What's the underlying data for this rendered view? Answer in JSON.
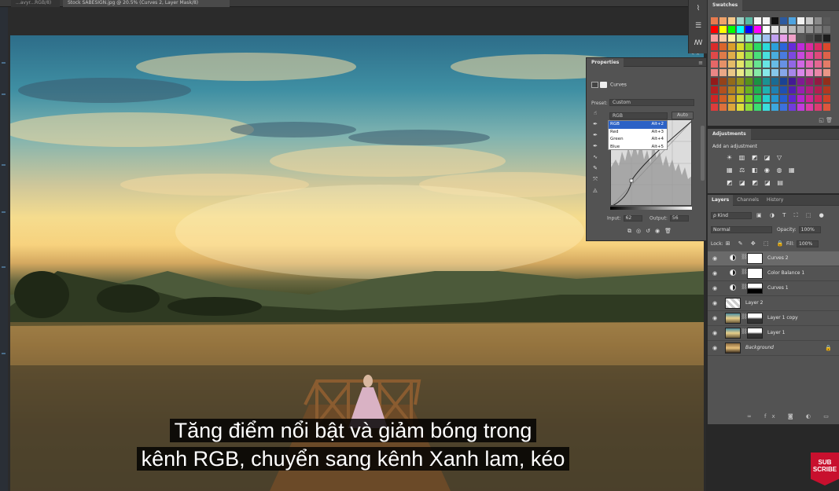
{
  "document_tabs": [
    {
      "label": "...avyr...RGB/8)"
    },
    {
      "label": "Stock SABESIGN.jpg @ 20.5% (Curves 2, Layer Mask/8)"
    }
  ],
  "subtitle": {
    "line1": "Tăng điểm nổi bật và giảm bóng trong",
    "line2": "kênh RGB, chuyển sang kênh Xanh lam, kéo"
  },
  "properties": {
    "tab": "Properties",
    "title": "Curves",
    "preset_label": "Preset:",
    "preset_value": "Custom",
    "channel_value": "RGB",
    "auto_label": "Auto",
    "channels": [
      {
        "name": "RGB",
        "shortcut": "Alt+2"
      },
      {
        "name": "Red",
        "shortcut": "Alt+3"
      },
      {
        "name": "Green",
        "shortcut": "Alt+4"
      },
      {
        "name": "Blue",
        "shortcut": "Alt+5"
      }
    ],
    "input_label": "Input:",
    "input_value": "62",
    "output_label": "Output:",
    "output_value": "56"
  },
  "swatches": {
    "tab": "Swatches",
    "colors": [
      "#e87a4e",
      "#f0a36a",
      "#f4c88a",
      "#9fd3c9",
      "#58b9a4",
      "#f4f4f4",
      "#f4f4f4",
      "#111111",
      "#2c5aa0",
      "#4ea3e0",
      "#f2f2f2",
      "#c8c8c8",
      "#8a8a8a",
      "#5a5a5a",
      "#ff0000",
      "#ffff00",
      "#00ff00",
      "#00ffff",
      "#0000ff",
      "#ff00ff",
      "#ffffff",
      "#e6e6e6",
      "#d0d0d0",
      "#bcbcbc",
      "#a8a8a8",
      "#949494",
      "#808080",
      "#6c6c6c",
      "#f5a0a0",
      "#f8c8a0",
      "#fdf0a0",
      "#c8f0a0",
      "#a0f0c8",
      "#a0e0f0",
      "#a0c0f0",
      "#c0a0f0",
      "#e8a0e8",
      "#f0a0c8",
      "#585858",
      "#444444",
      "#303030",
      "#1c1c1c"
    ]
  },
  "adjustments": {
    "tab": "Adjustments",
    "subtitle": "Add an adjustment",
    "row1": "☀ ▥ ◩ ◪ ▽",
    "row2": "▦ ⚖ ◧ ◉ ◍ ▦",
    "row3": "◩ ◪ ◩ ◪ ▤"
  },
  "layers_panel": {
    "tabs": [
      "Layers",
      "Channels",
      "History"
    ],
    "kind_label": "ρ Kind",
    "filter_icons": "▣ ◑ T ⛶ ⬚ ●",
    "blend_mode": "Normal",
    "opacity_label": "Opacity:",
    "opacity_value": "100%",
    "lock_label": "Lock:",
    "lock_icons": "⊞ ✎ ✥ ⬚ 🔒",
    "fill_label": "Fill:",
    "fill_value": "100%",
    "layers": [
      {
        "name": "Curves 2",
        "kind": "adjustment"
      },
      {
        "name": "Color Balance 1",
        "kind": "adjustment"
      },
      {
        "name": "Curves 1",
        "kind": "adjustment"
      },
      {
        "name": "Layer 2",
        "kind": "pixel"
      },
      {
        "name": "Layer 1 copy",
        "kind": "pixel-mask"
      },
      {
        "name": "Layer 1",
        "kind": "pixel-mask"
      },
      {
        "name": "Background",
        "kind": "background"
      }
    ],
    "footer_icons": "∞ fx ◙ ◐ ▭ ⊞ 🗑"
  },
  "subscribe_badge": "SUB SCRIBE"
}
